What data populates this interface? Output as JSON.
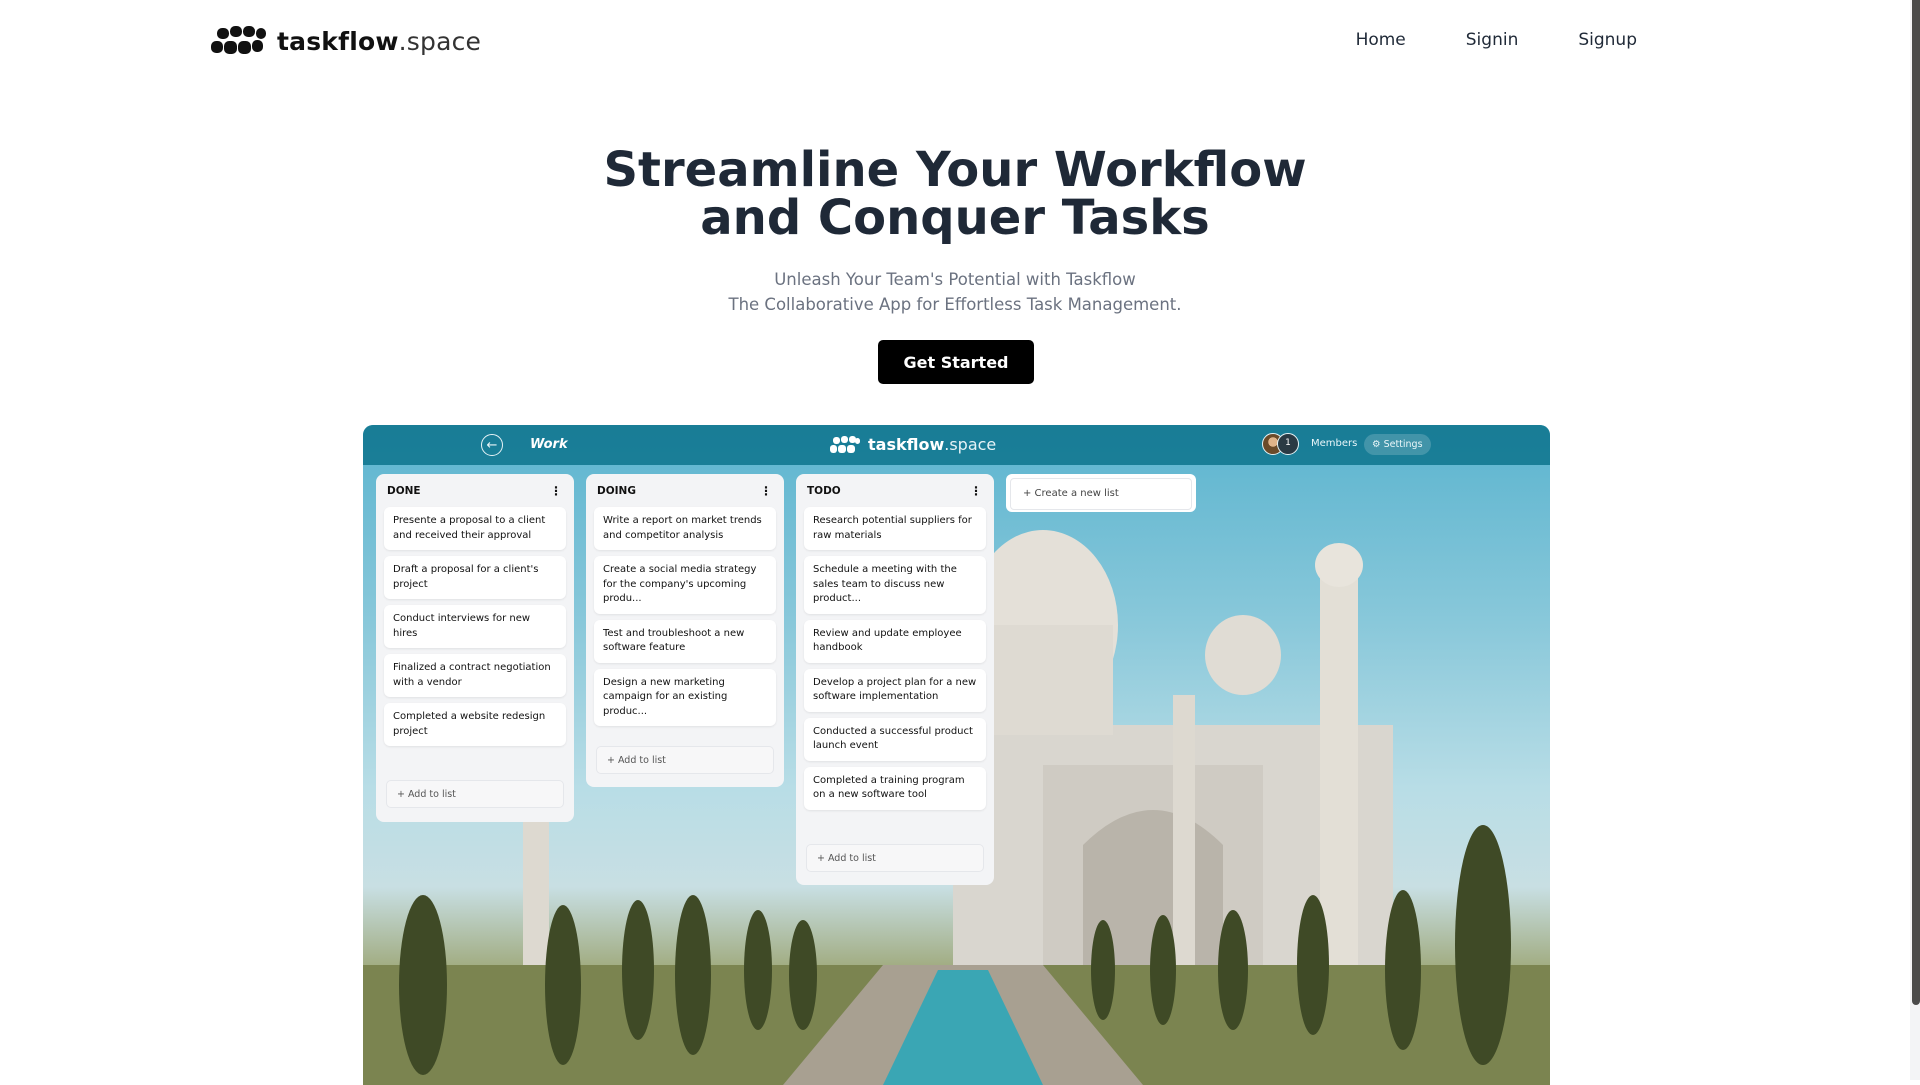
{
  "brand": {
    "name": "taskflow",
    "tld": ".space"
  },
  "nav": {
    "home": "Home",
    "signin": "Signin",
    "signup": "Signup"
  },
  "hero": {
    "title_line1": "Streamline Your Workflow",
    "title_line2": "and Conquer Tasks",
    "subtitle_line1": "Unleash Your Team's Potential with Taskflow",
    "subtitle_line2": "The Collaborative App for Effortless Task Management.",
    "cta_label": "Get Started"
  },
  "preview": {
    "board_name": "Work",
    "member_count": "1",
    "members_label": "Members",
    "settings_label": "Settings",
    "add_label": "+ Add to list",
    "create_list_label": "+ Create a new list",
    "lists": [
      {
        "title": "DONE",
        "cards": [
          "Presente a proposal to a client and received their approval",
          "Draft a proposal for a client's project",
          "Conduct interviews for new hires",
          "Finalized a contract negotiation with a vendor",
          "Completed a website redesign project"
        ]
      },
      {
        "title": "DOING",
        "cards": [
          "Write a report on market trends and competitor analysis",
          "Create a social media strategy for the company's upcoming produ...",
          "Test and troubleshoot a new software feature",
          "Design a new marketing campaign for an existing produc..."
        ]
      },
      {
        "title": "TODO",
        "cards": [
          "Research potential suppliers for raw materials",
          "Schedule a meeting with the sales team to discuss new product...",
          "Review and update employee handbook",
          "Develop a project plan for a new software implementation",
          "Conducted a successful product launch event",
          "Completed a training program on a new software tool"
        ]
      }
    ]
  }
}
